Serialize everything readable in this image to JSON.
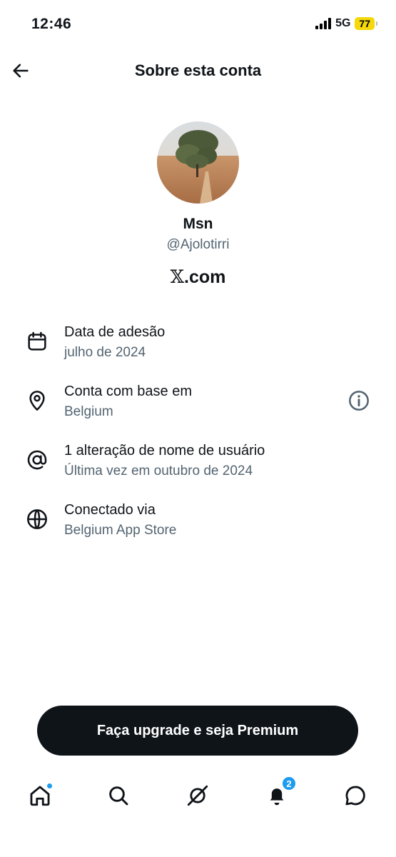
{
  "status_bar": {
    "time": "12:46",
    "network": "5G",
    "battery": "77"
  },
  "header": {
    "title": "Sobre esta conta"
  },
  "profile": {
    "name": "Msn",
    "handle": "@Ajolotirri",
    "site_mark": "𝕏",
    "site_suffix": ".com"
  },
  "info": [
    {
      "icon": "calendar-icon",
      "title": "Data de adesão",
      "subtitle": "julho de 2024"
    },
    {
      "icon": "location-pin-icon",
      "title": "Conta com base em",
      "subtitle": "Belgium"
    },
    {
      "icon": "at-sign-icon",
      "title": "1 alteração de nome de usuário",
      "subtitle": "Última vez em outubro de 2024"
    },
    {
      "icon": "globe-icon",
      "title": "Conectado via",
      "subtitle": "Belgium App Store"
    }
  ],
  "premium": {
    "label": "Faça upgrade e seja Premium"
  },
  "tabs": [
    {
      "icon": "home-icon"
    },
    {
      "icon": "search-icon"
    },
    {
      "icon": "grok-icon"
    },
    {
      "icon": "bell-icon",
      "badge": "2"
    },
    {
      "icon": "messages-icon"
    }
  ],
  "colors": {
    "text": "#0f1419",
    "secondary": "#536471",
    "accent": "#1d9bf0",
    "battery": "#f5d90a"
  }
}
